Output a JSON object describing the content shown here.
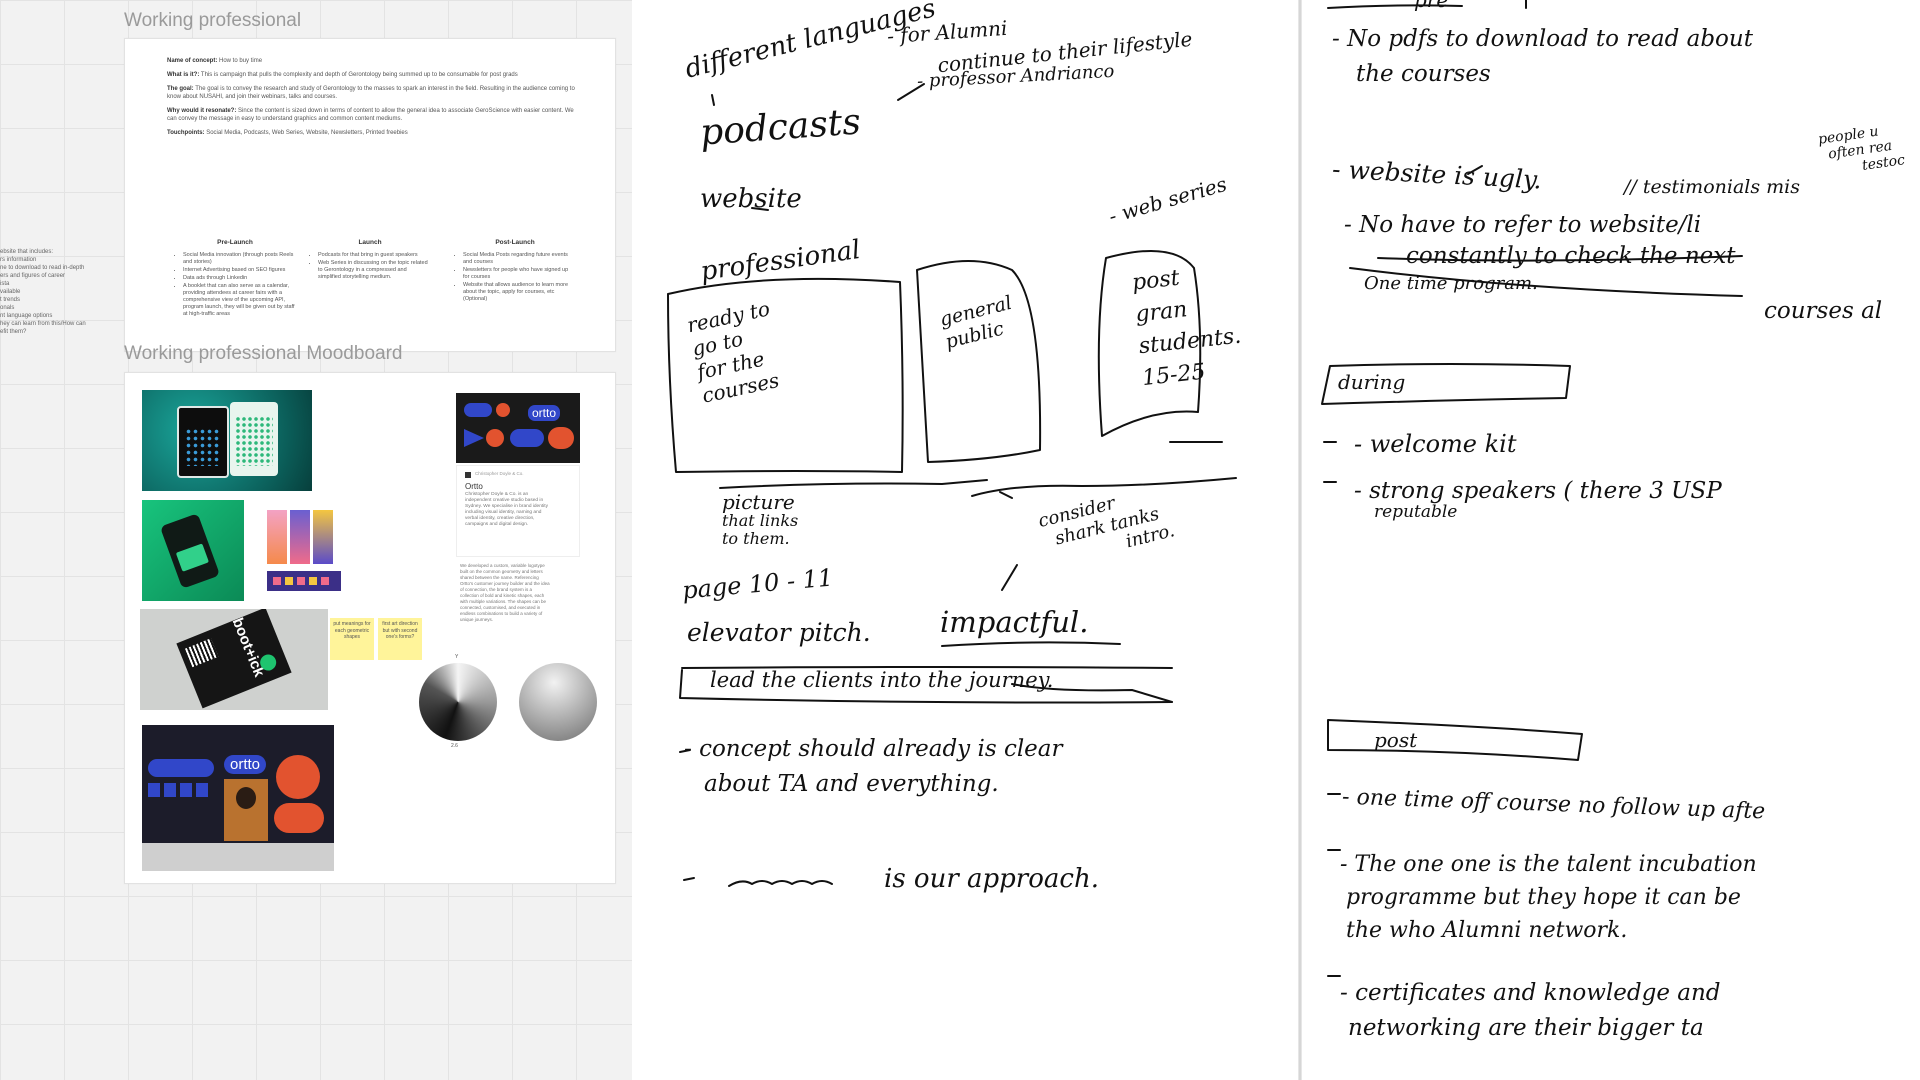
{
  "board": {
    "frame1_title": "Working professional",
    "frame2_title": "Working professional Moodboard",
    "left_notes": [
      "ebsite that includes:",
      "rs information",
      "ne to download to read in-depth",
      "ers and figures of career",
      "ista",
      "vailable",
      "t trends",
      "onals",
      "nt language options",
      "hey can learn from this/How can",
      "efit them?"
    ],
    "concept": {
      "name_label": "Name of concept:",
      "name_value": "How to buy time",
      "what_label": "What is it?:",
      "what_value": "This is campaign that pulls the complexity and depth of Gerontology being summed up to be consumable for post grads",
      "goal_label": "The goal:",
      "goal_value": "The goal is to convey the research and study of Gerontology to the masses to spark an interest in the field. Resulting in the audience coming to know about NUSAHI, and join their webinars, talks and courses.",
      "why_label": "Why would it resonate?:",
      "why_value": "Since the content is sized down in terms of content to allow the general idea to associate GeroScience with easier content. We can convey the message in easy to understand graphics and common content mediums.",
      "touch_label": "Touchpoints:",
      "touch_value": "Social Media, Podcasts, Web Series, Website, Newsletters, Printed freebies"
    },
    "phases": [
      {
        "title": "Pre-Launch",
        "items": [
          "Social Media innovation (through posts Reels and stories)",
          "Internet Advertising based on SEO figures",
          "Data ads through Linkedin",
          "A booklet that can also serve as a calendar, providing attendees at career fairs with a comprehensive view of the upcoming API, program launch, they will be given out by staff at high-traffic areas"
        ]
      },
      {
        "title": "Launch",
        "items": [
          "Podcasts for that bring in guest speakers",
          "Web Series in discussing on the topic related to Gerontology in a compressed and simplified storytelling medium."
        ]
      },
      {
        "title": "Post-Launch",
        "items": [
          "Social Media Posts regarding future events and courses",
          "Newsletters for people who have signed up for courses",
          "Website that allows audience to learn more about the topic, apply for courses, etc (Optional)"
        ]
      }
    ],
    "moodboard": {
      "ortto_logo": "ortto",
      "ortto_heading": "Ortto",
      "ortto_byline": "Christopher Doyle & Co.",
      "ortto_desc": "Christopher Doyle & Co. is an independent creative studio based in Sydney. We specialise in brand identity including visual identity, naming and verbal identity, creative direction, campaigns and digital design.",
      "ortto_desc2": "We developed a custom, variable logotype built on the common geometry and letters shared between the name. Referencing Ortto's customer journey builder and the idea of connection, the brand system is a collection of bold and kinetic shapes, each with multiple variations. The shapes can be connected, customised, and executed in endless combinations to build a variety of unique journeys.",
      "sticky1": "put meanings for each geometric shapes",
      "sticky2": "first art direction but with second one's forms?",
      "bootick": "boot+ick",
      "billboard_logo": "ortto",
      "gradient_top_label": "Y",
      "gradient_bottom_label": "2.6"
    }
  },
  "notebook": {
    "left_page": {
      "languages": "different languages",
      "languages_mark": "|",
      "alumni_note": "- for Alumni",
      "lifestyle_note": "continue to their lifestyle",
      "professor_note": "- professor Andrianco",
      "podcasts": "podcasts",
      "website": "website",
      "web_series": "- web series",
      "professional": "professional",
      "box1": [
        "ready to",
        "go to",
        "for the",
        "courses"
      ],
      "box2": [
        "general",
        "public"
      ],
      "box3": [
        "post",
        "gran",
        "students.",
        "15-25"
      ],
      "picture": "picture",
      "picture_note": [
        "that links",
        "to them."
      ],
      "consider": [
        "consider",
        "shark tanks",
        "intro."
      ],
      "page_ref": "page 10 - 11",
      "elevator": "elevator pitch.",
      "impactful": "impactful.",
      "lead": "lead the clients into the journey.",
      "concept": [
        "- concept should already is clear",
        "about TA and everything."
      ],
      "approach": "is our approach."
    },
    "right_page": {
      "pre": "pre",
      "pdf": [
        "- No pdfs to download to read about",
        "the courses"
      ],
      "people": [
        "people u",
        "often rea",
        "testoc"
      ],
      "website_ugly": "- website is ugly.",
      "testimonials": "// testimonials mis",
      "refer": [
        "- No have to refer to website/li",
        "constantly to check the next",
        "One time program.",
        "courses al"
      ],
      "during": "during",
      "welcome": "- welcome kit",
      "speakers": "- strong speakers ( there 3 USP",
      "reputable": "reputable",
      "post": "post",
      "one_time": "- one time off course no follow up afte",
      "incubation": [
        "- The one one is the talent incubation",
        "programme but they hope it can be",
        "the who Alumni network."
      ],
      "certificates": [
        "- certificates and knowledge and",
        "networking are their bigger ta"
      ]
    }
  }
}
